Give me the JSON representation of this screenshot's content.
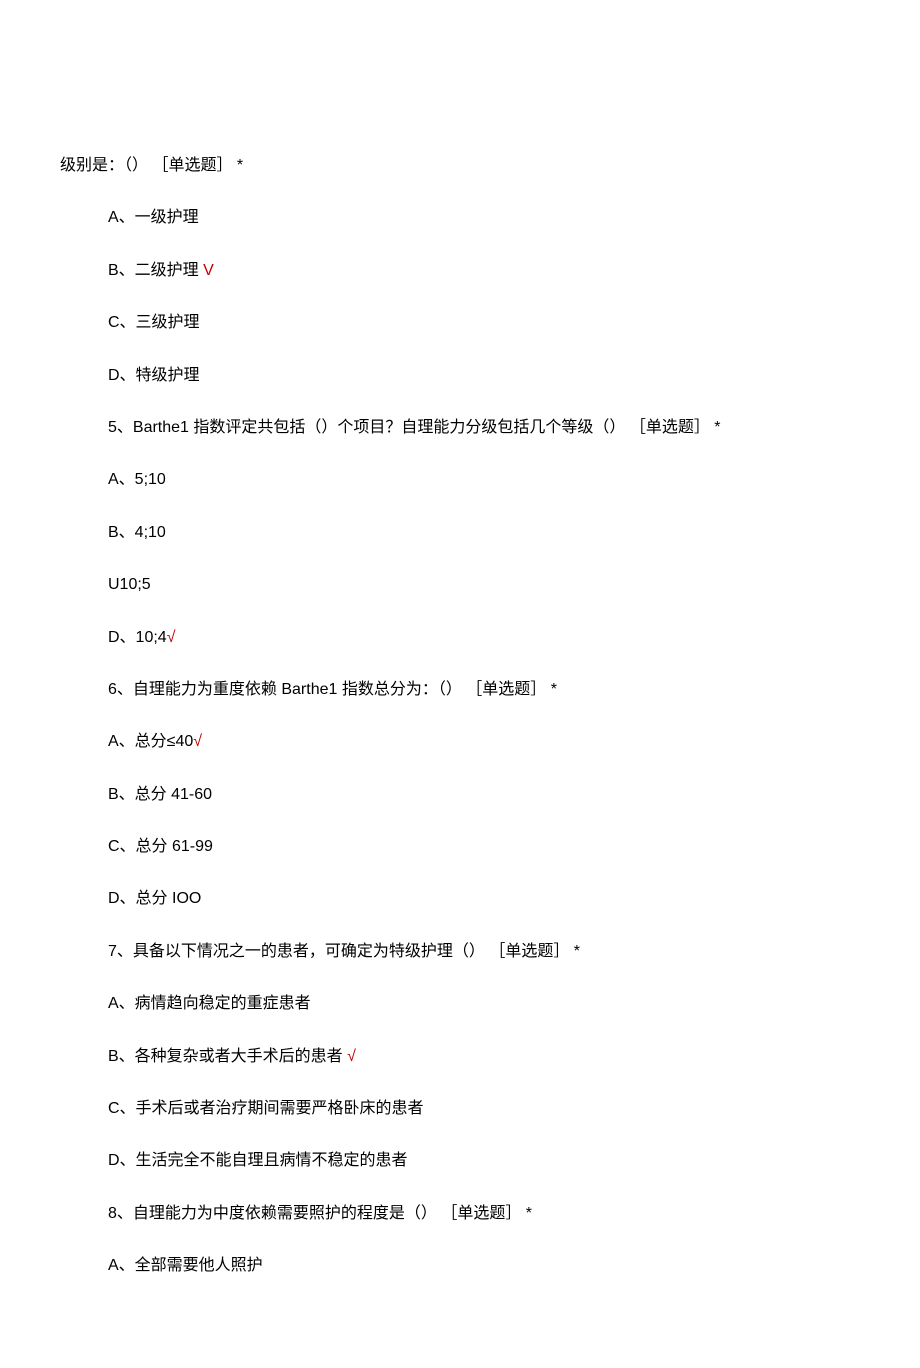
{
  "cont_line": "级别是：（） ［单选题］ *",
  "q4": {
    "A": "A、一级护理",
    "B_pre": "B、二级护理 ",
    "B_check": "V",
    "C": "C、三级护理",
    "D": "D、特级护理"
  },
  "q5": {
    "stem": "5、Barthe1 指数评定共包括（）个项目？自理能力分级包括几个等级（） ［单选题］ *",
    "A": "A、5;10",
    "B": "B、4;10",
    "C": "U10;5",
    "D_pre": "D、10;4",
    "D_check": "√"
  },
  "q6": {
    "stem": "6、自理能力为重度依赖 Barthe1 指数总分为：（） ［单选题］ *",
    "A_pre": "A、总分≤40",
    "A_check": "√",
    "B": "B、总分 41-60",
    "C": "C、总分 61-99",
    "D": "D、总分 IOO"
  },
  "q7": {
    "stem": "7、具备以下情况之一的患者，可确定为特级护理（） ［单选题］ *",
    "A": "A、病情趋向稳定的重症患者",
    "B_pre": "B、各种复杂或者大手术后的患者 ",
    "B_check": "√",
    "C": "C、手术后或者治疗期间需要严格卧床的患者",
    "D": "D、生活完全不能自理且病情不稳定的患者"
  },
  "q8": {
    "stem": "8、自理能力为中度依赖需要照护的程度是（） ［单选题］ *",
    "A": "A、全部需要他人照护"
  }
}
